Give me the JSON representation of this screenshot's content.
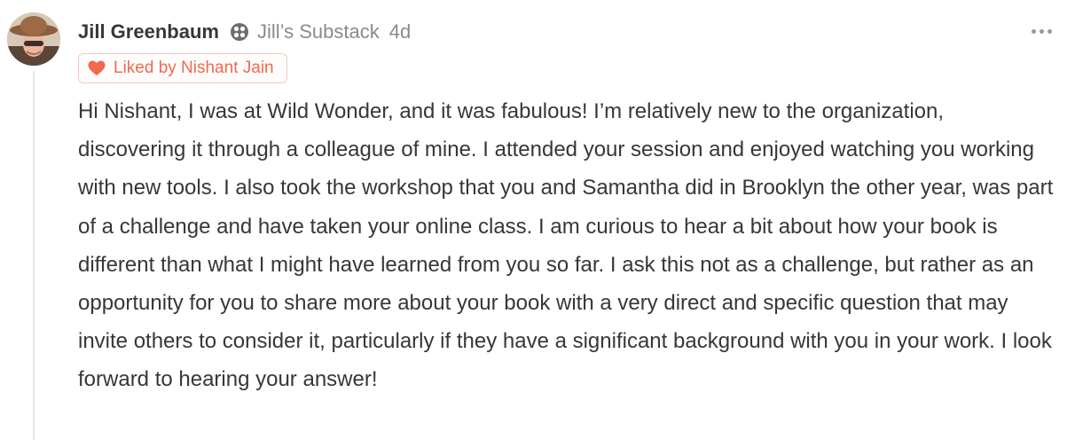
{
  "comment": {
    "author": "Jill Greenbaum",
    "publication": "Jill’s Substack",
    "age": "4d",
    "liked_by": "Liked by Nishant Jain",
    "body": "Hi Nishant, I was at Wild Wonder, and it was fabulous! I’m relatively new to the organization, discovering it through a colleague of mine. I attended your session and enjoyed watching you working with new tools. I also took the workshop that you and Samantha did in Brooklyn the other year, was part of a challenge and have taken your online class. I am curious to hear a bit about how your book is different than what I might have learned from you so far. I ask this not as a challenge, but rather as an opportunity for you to share more about your book with a very direct and specific question that may invite others to consider it, particularly if they have a significant background with you in your work. I look forward to hearing your answer!",
    "icons": {
      "publication": "substack-publication-icon",
      "liked": "heart-icon",
      "more": "more-options-icon"
    },
    "colors": {
      "liked_accent": "#ef6a4e",
      "muted_text": "#8a8a8a",
      "body_text": "#363737"
    }
  }
}
